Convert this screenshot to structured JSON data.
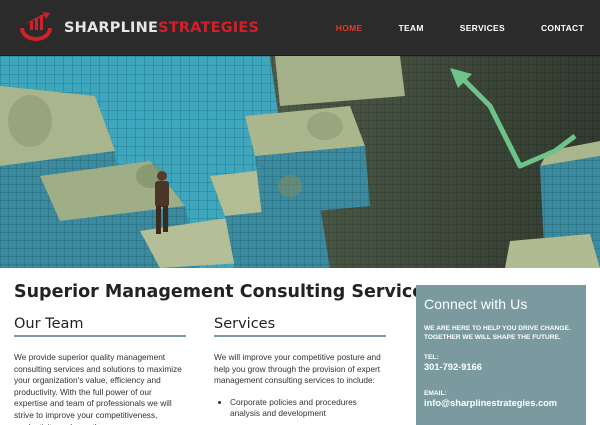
{
  "header": {
    "logo_part1": "SHARPLINE",
    "logo_part2": "STRATEGIES",
    "nav": [
      {
        "label": "HOME",
        "active": true
      },
      {
        "label": "TEAM",
        "active": false
      },
      {
        "label": "SERVICES",
        "active": false
      },
      {
        "label": "CONTACT",
        "active": false
      }
    ]
  },
  "main": {
    "title": "Superior Management Consulting Services",
    "team": {
      "heading": "Our Team",
      "body": "We provide superior quality management consulting services and solutions to maximize your organization's value, efficiency and productivity.  With the full power of our expertise and team of professionals we will strive to improve your competitiveness, productivity and growth."
    },
    "services": {
      "heading": "Services",
      "body": "We will improve your competitive posture and help you grow through the provision of expert management consulting services to include:",
      "items": [
        "Corporate policies and procedures analysis and development"
      ]
    }
  },
  "connect": {
    "heading": "Connect with Us",
    "tagline_1": "WE ARE HERE TO HELP YOU DRIVE CHANGE.",
    "tagline_2": "TOGETHER WE WILL SHAPE THE FUTURE.",
    "tel_label": "TEL:",
    "tel": "301-792-9166",
    "email_label": "EMAIL:",
    "email": "info@sharplinestrategies.com"
  },
  "colors": {
    "header_bg": "#2b2b2b",
    "brand_red": "#d0202a",
    "nav_active": "#e03a2b",
    "panel_teal": "#7a9aa0"
  }
}
